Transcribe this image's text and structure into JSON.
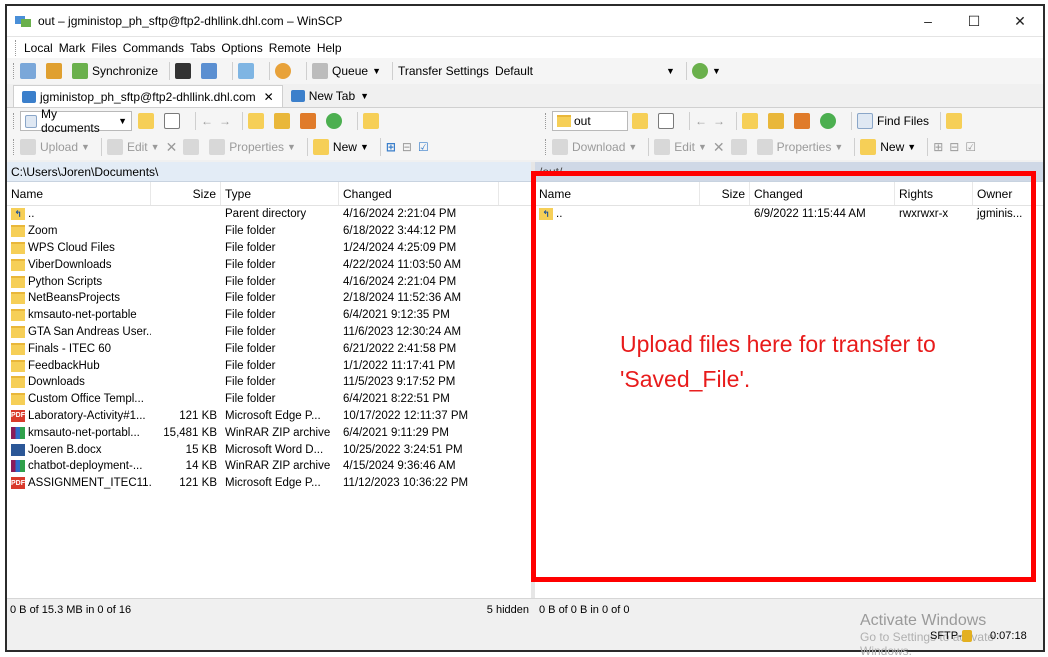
{
  "window": {
    "title": "out – jgministop_ph_sftp@ftp2-dhllink.dhl.com – WinSCP",
    "minimize": "–",
    "maximize": "☐",
    "close": "✕"
  },
  "menu": [
    "Local",
    "Mark",
    "Files",
    "Commands",
    "Tabs",
    "Options",
    "Remote",
    "Help"
  ],
  "toolbar1": {
    "synchronize": "Synchronize",
    "queue": "Queue",
    "transfer_settings": "Transfer Settings",
    "transfer_profile": "Default"
  },
  "tabs": {
    "session": "jgministop_ph_sftp@ftp2-dhllink.dhl.com",
    "session_close": "✕",
    "new_tab": "New Tab"
  },
  "left_toolbar": {
    "location": "My documents",
    "upload": "Upload",
    "edit": "Edit",
    "properties": "Properties",
    "new": "New"
  },
  "right_toolbar": {
    "location": "out",
    "find_files": "Find Files",
    "download": "Download",
    "edit": "Edit",
    "properties": "Properties",
    "new": "New"
  },
  "left_panel": {
    "path": "C:\\Users\\Joren\\Documents\\",
    "columns": {
      "name": "Name",
      "size": "Size",
      "type": "Type",
      "changed": "Changed"
    },
    "rows": [
      {
        "icon": "parent",
        "name": "..",
        "size": "",
        "type": "Parent directory",
        "changed": "4/16/2024 2:21:04 PM"
      },
      {
        "icon": "folder",
        "name": "Zoom",
        "size": "",
        "type": "File folder",
        "changed": "6/18/2022 3:44:12 PM"
      },
      {
        "icon": "folder",
        "name": "WPS Cloud Files",
        "size": "",
        "type": "File folder",
        "changed": "1/24/2024 4:25:09 PM"
      },
      {
        "icon": "folder",
        "name": "ViberDownloads",
        "size": "",
        "type": "File folder",
        "changed": "4/22/2024 11:03:50 AM"
      },
      {
        "icon": "folder",
        "name": "Python Scripts",
        "size": "",
        "type": "File folder",
        "changed": "4/16/2024 2:21:04 PM"
      },
      {
        "icon": "folder",
        "name": "NetBeansProjects",
        "size": "",
        "type": "File folder",
        "changed": "2/18/2024 11:52:36 AM"
      },
      {
        "icon": "folder",
        "name": "kmsauto-net-portable",
        "size": "",
        "type": "File folder",
        "changed": "6/4/2021 9:12:35 PM"
      },
      {
        "icon": "folder",
        "name": "GTA San Andreas User...",
        "size": "",
        "type": "File folder",
        "changed": "11/6/2023 12:30:24 AM"
      },
      {
        "icon": "folder",
        "name": "Finals - ITEC 60",
        "size": "",
        "type": "File folder",
        "changed": "6/21/2022 2:41:58 PM"
      },
      {
        "icon": "folder",
        "name": "FeedbackHub",
        "size": "",
        "type": "File folder",
        "changed": "1/1/2022 11:17:41 PM"
      },
      {
        "icon": "folder",
        "name": "Downloads",
        "size": "",
        "type": "File folder",
        "changed": "11/5/2023 9:17:52 PM"
      },
      {
        "icon": "folder",
        "name": "Custom Office Templ...",
        "size": "",
        "type": "File folder",
        "changed": "6/4/2021 8:22:51 PM"
      },
      {
        "icon": "pdf",
        "name": "Laboratory-Activity#1...",
        "size": "121 KB",
        "type": "Microsoft Edge P...",
        "changed": "10/17/2022 12:11:37 PM"
      },
      {
        "icon": "zip",
        "name": "kmsauto-net-portabl...",
        "size": "15,481 KB",
        "type": "WinRAR ZIP archive",
        "changed": "6/4/2021 9:11:29 PM"
      },
      {
        "icon": "docx",
        "name": "Joeren B.docx",
        "size": "15 KB",
        "type": "Microsoft Word D...",
        "changed": "10/25/2022 3:24:51 PM"
      },
      {
        "icon": "zip",
        "name": "chatbot-deployment-...",
        "size": "14 KB",
        "type": "WinRAR ZIP archive",
        "changed": "4/15/2024 9:36:46 AM"
      },
      {
        "icon": "pdf",
        "name": "ASSIGNMENT_ITEC11...",
        "size": "121 KB",
        "type": "Microsoft Edge P...",
        "changed": "11/12/2023 10:36:22 PM"
      }
    ]
  },
  "right_panel": {
    "path": "/out/",
    "columns": {
      "name": "Name",
      "size": "Size",
      "changed": "Changed",
      "rights": "Rights",
      "owner": "Owner"
    },
    "rows": [
      {
        "icon": "parent",
        "name": "..",
        "size": "",
        "changed": "6/9/2022 11:15:44 AM",
        "rights": "rwxrwxr-x",
        "owner": "jgminis..."
      }
    ]
  },
  "annotation": {
    "text": "Upload files here for transfer to 'Saved_File'.",
    "color": "#ff0000"
  },
  "status": {
    "left": "0 B of 15.3 MB in 0 of 16",
    "hidden": "5 hidden",
    "right": "0 B of 0 B in 0 of 0",
    "protocol": "SFTP-6",
    "elapsed": "0:07:18"
  },
  "watermark": {
    "line1": "Activate Windows",
    "line2": "Go to Settings to activate Windows."
  }
}
